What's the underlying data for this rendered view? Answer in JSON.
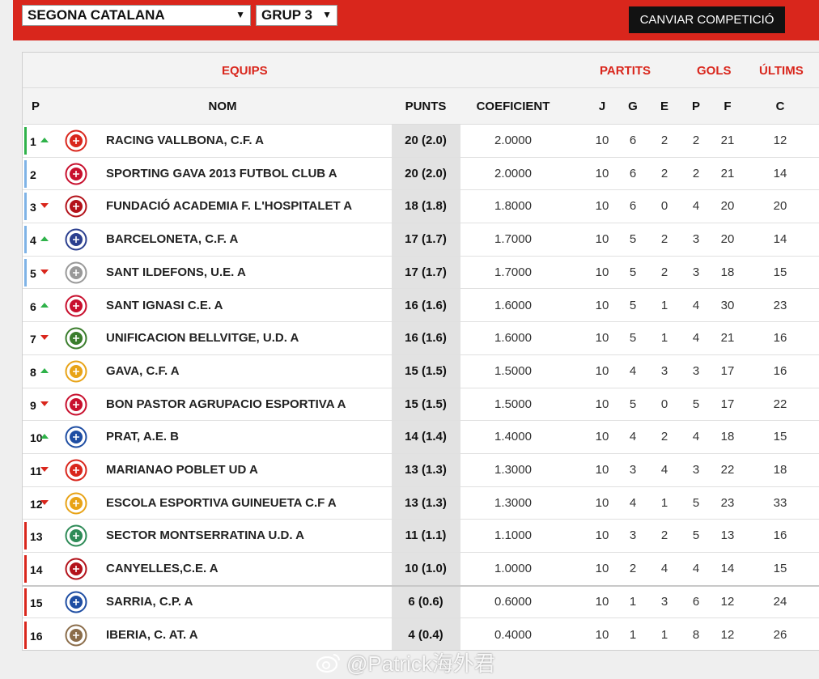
{
  "filters": {
    "competition": "SEGONA CATALANA",
    "group": "GRUP 3",
    "change_button": "CANVIAR COMPETICIÓ"
  },
  "header": {
    "equips": "EQUIPS",
    "partits": "PARTITS",
    "gols": "GOLS",
    "ultims": "ÚLTIMS",
    "p": "P",
    "nom": "NOM",
    "punts": "PUNTS",
    "coeficient": "COEFICIENT",
    "j": "J",
    "g": "G",
    "e": "E",
    "p2": "P",
    "f": "F",
    "c": "C"
  },
  "colors": {
    "brand_red": "#d9261c",
    "promotion_green": "#2fb24a",
    "playoff_blue": "#7fb3e6",
    "relegation_red": "#d9261c"
  },
  "rows": [
    {
      "pos": "1",
      "trend": "up",
      "zone": "green",
      "name": "RACING VALLBONA, C.F. A",
      "punts": "20 (2.0)",
      "coef": "2.0000",
      "j": "10",
      "g": "6",
      "e": "2",
      "p": "2",
      "f": "21",
      "c": "12",
      "crest": "#d9261c"
    },
    {
      "pos": "2",
      "trend": "",
      "zone": "blue",
      "name": "SPORTING GAVA 2013 FUTBOL CLUB A",
      "punts": "20 (2.0)",
      "coef": "2.0000",
      "j": "10",
      "g": "6",
      "e": "2",
      "p": "2",
      "f": "21",
      "c": "14",
      "crest": "#c8102e"
    },
    {
      "pos": "3",
      "trend": "down",
      "zone": "blue",
      "name": "FUNDACIÓ ACADEMIA F. L'HOSPITALET A",
      "punts": "18 (1.8)",
      "coef": "1.8000",
      "j": "10",
      "g": "6",
      "e": "0",
      "p": "4",
      "f": "20",
      "c": "20",
      "crest": "#b3121a"
    },
    {
      "pos": "4",
      "trend": "up",
      "zone": "blue",
      "name": "BARCELONETA, C.F. A",
      "punts": "17 (1.7)",
      "coef": "1.7000",
      "j": "10",
      "g": "5",
      "e": "2",
      "p": "3",
      "f": "20",
      "c": "14",
      "crest": "#2b3f8f"
    },
    {
      "pos": "5",
      "trend": "down",
      "zone": "blue",
      "name": "SANT ILDEFONS, U.E. A",
      "punts": "17 (1.7)",
      "coef": "1.7000",
      "j": "10",
      "g": "5",
      "e": "2",
      "p": "3",
      "f": "18",
      "c": "15",
      "crest": "#999999"
    },
    {
      "pos": "6",
      "trend": "up",
      "zone": "",
      "name": "SANT IGNASI C.E. A",
      "punts": "16 (1.6)",
      "coef": "1.6000",
      "j": "10",
      "g": "5",
      "e": "1",
      "p": "4",
      "f": "30",
      "c": "23",
      "crest": "#c8102e"
    },
    {
      "pos": "7",
      "trend": "down",
      "zone": "",
      "name": "UNIFICACION BELLVITGE, U.D. A",
      "punts": "16 (1.6)",
      "coef": "1.6000",
      "j": "10",
      "g": "5",
      "e": "1",
      "p": "4",
      "f": "21",
      "c": "16",
      "crest": "#3a7d2c"
    },
    {
      "pos": "8",
      "trend": "up",
      "zone": "",
      "name": "GAVA, C.F. A",
      "punts": "15 (1.5)",
      "coef": "1.5000",
      "j": "10",
      "g": "4",
      "e": "3",
      "p": "3",
      "f": "17",
      "c": "16",
      "crest": "#e8a317"
    },
    {
      "pos": "9",
      "trend": "down",
      "zone": "",
      "name": "BON PASTOR AGRUPACIO ESPORTIVA A",
      "punts": "15 (1.5)",
      "coef": "1.5000",
      "j": "10",
      "g": "5",
      "e": "0",
      "p": "5",
      "f": "17",
      "c": "22",
      "crest": "#c8102e"
    },
    {
      "pos": "10",
      "trend": "up",
      "zone": "",
      "name": "PRAT, A.E. B",
      "punts": "14 (1.4)",
      "coef": "1.4000",
      "j": "10",
      "g": "4",
      "e": "2",
      "p": "4",
      "f": "18",
      "c": "15",
      "crest": "#1f4ea3"
    },
    {
      "pos": "11",
      "trend": "down",
      "zone": "",
      "name": "MARIANAO POBLET UD A",
      "punts": "13 (1.3)",
      "coef": "1.3000",
      "j": "10",
      "g": "3",
      "e": "4",
      "p": "3",
      "f": "22",
      "c": "18",
      "crest": "#d9261c"
    },
    {
      "pos": "12",
      "trend": "down",
      "zone": "",
      "name": "ESCOLA ESPORTIVA GUINEUETA C.F A",
      "punts": "13 (1.3)",
      "coef": "1.3000",
      "j": "10",
      "g": "4",
      "e": "1",
      "p": "5",
      "f": "23",
      "c": "33",
      "crest": "#e8a317"
    },
    {
      "pos": "13",
      "trend": "",
      "zone": "red",
      "name": "SECTOR MONTSERRATINA U.D. A",
      "punts": "11 (1.1)",
      "coef": "1.1000",
      "j": "10",
      "g": "3",
      "e": "2",
      "p": "5",
      "f": "13",
      "c": "16",
      "crest": "#2e8b57"
    },
    {
      "pos": "14",
      "trend": "",
      "zone": "red",
      "name": "CANYELLES,C.E. A",
      "punts": "10 (1.0)",
      "coef": "1.0000",
      "j": "10",
      "g": "2",
      "e": "4",
      "p": "4",
      "f": "14",
      "c": "15",
      "crest": "#b3121a"
    },
    {
      "pos": "15",
      "trend": "",
      "zone": "red",
      "name": "SARRIA, C.P. A",
      "punts": "6 (0.6)",
      "coef": "0.6000",
      "j": "10",
      "g": "1",
      "e": "3",
      "p": "6",
      "f": "12",
      "c": "24",
      "crest": "#1f4ea3"
    },
    {
      "pos": "16",
      "trend": "",
      "zone": "red",
      "name": "IBERIA, C. AT. A",
      "punts": "4 (0.4)",
      "coef": "0.4000",
      "j": "10",
      "g": "1",
      "e": "1",
      "p": "8",
      "f": "12",
      "c": "26",
      "crest": "#8b6d4a"
    }
  ],
  "watermark": "@Patrick海外君"
}
